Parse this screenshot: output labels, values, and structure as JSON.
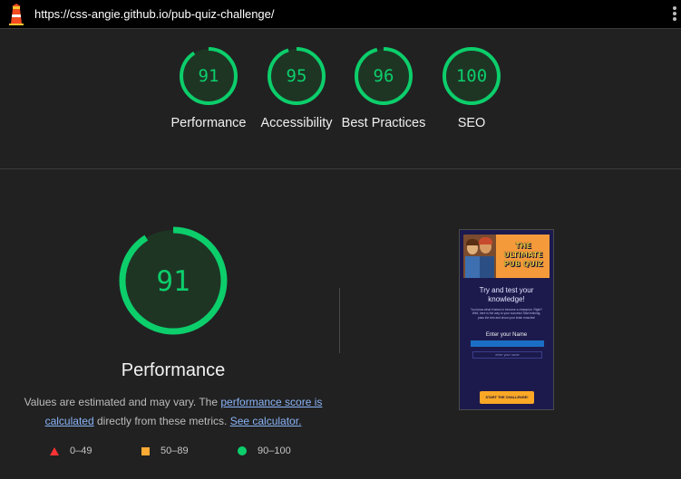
{
  "topbar": {
    "url": "https://css-angie.github.io/pub-quiz-challenge/",
    "logo_icon": "lighthouse-icon",
    "menu_icon": "more-vert-icon"
  },
  "categories": [
    {
      "score": "91",
      "value": 91,
      "label": "Performance"
    },
    {
      "score": "95",
      "value": 95,
      "label": "Accessibility"
    },
    {
      "score": "96",
      "value": 96,
      "label": "Best Practices"
    },
    {
      "score": "100",
      "value": 100,
      "label": "SEO"
    }
  ],
  "performance": {
    "score": "91",
    "value": 91,
    "title": "Performance",
    "note_prefix": "Values are estimated and may vary. The ",
    "note_link": "performance score is calculated",
    "note_middle": " directly from these metrics. ",
    "calc_link": "See calculator."
  },
  "legend": [
    {
      "range": "0–49",
      "icon": "fail-triangle-icon",
      "color": "#ff3333"
    },
    {
      "range": "50–89",
      "icon": "average-square-icon",
      "color": "#ffaa33"
    },
    {
      "range": "90–100",
      "icon": "pass-circle-icon",
      "color": "#0cce6b"
    }
  ],
  "thumbnail": {
    "logo": "THE ULTIMATE PUB QUIZ",
    "heading": "Try and test your knowledge!",
    "body": "You know what it takes to become a champion. Right? Well, here is the way to your success! Start training, pass the test and show your brain muscles!",
    "name_label": "Enter your Name",
    "name_placeholder": "enter your name",
    "start_button": "START THE CHALLENGE!"
  },
  "colors": {
    "pass": "#0cce6b",
    "gauge_fill": "#1e3524",
    "link": "#8ab4f8",
    "background": "#212121"
  }
}
